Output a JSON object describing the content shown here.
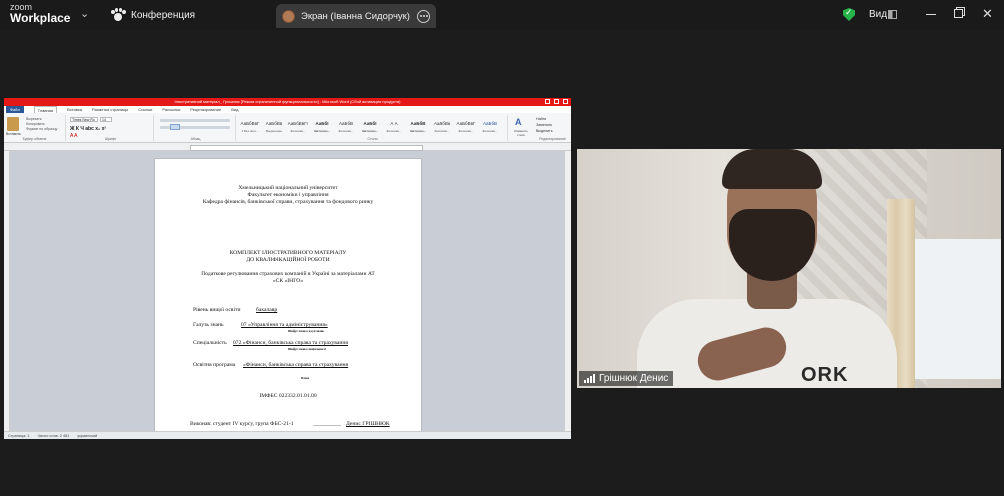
{
  "app": {
    "logo_line1": "zoom",
    "logo_line2": "Workplace",
    "meeting_label": "Конференция",
    "share_tab_label": "Экран (Іванна Сидорчук)",
    "view_label": "Вид"
  },
  "word": {
    "title": "Ілюстративний матеріал_ Гришнюк [Режим ограниченной функциональности] - Microsoft Word (Сбой активации продукта)",
    "tabs": [
      "Файл",
      "Главная",
      "Вставка",
      "Разметка страницы",
      "Ссылки",
      "Рассылки",
      "Рецензирование",
      "Вид"
    ],
    "font_name": "Times New Ro",
    "font_size": "14",
    "group_labels": [
      "Буфер обмена",
      "Шрифт",
      "Абзац",
      "Стили",
      "Редактирование"
    ],
    "clipboard_items": [
      "Вырезать",
      "Копировать",
      "Формат по образцу"
    ],
    "paste_label": "Вставить",
    "styles": [
      {
        "sample": "АаБбВвГ",
        "name": "1 Без инте..."
      },
      {
        "sample": "АаБбВв",
        "name": "Выделение"
      },
      {
        "sample": "АаБбВвГг",
        "name": "Заголово..."
      },
      {
        "sample": "АаБбІ",
        "name": "Заголово..."
      },
      {
        "sample": "АаБбВ",
        "name": "Заголово..."
      },
      {
        "sample": "АаБбІ",
        "name": "Заголово..."
      },
      {
        "sample": "А А",
        "name": "Заголово..."
      },
      {
        "sample": "АаБбВ",
        "name": "Заголово..."
      },
      {
        "sample": "АаБбВв",
        "name": "Заголово..."
      },
      {
        "sample": "АаБбВвГ",
        "name": "Заголово..."
      },
      {
        "sample": "АаБбВ",
        "name": "Заголово..."
      },
      {
        "sample": "АаБбВ",
        "name": "Название"
      }
    ],
    "change_styles": "Изменить стили",
    "editing": [
      "Найти",
      "Заменить",
      "Выделить"
    ],
    "status": [
      "Страница: 1",
      "Число слов: 2 481",
      "украинский"
    ]
  },
  "document": {
    "uni": "Хмельницький національний університет",
    "faculty": "Факультет економіки і управління",
    "department": "Кафедра фінансів, банківської справи, страхування та фондового ринку",
    "heading1": "КОМПЛЕКТ ІЛЮСТРАТИВНОГО МАТЕРІАЛУ",
    "heading2": "ДО  КВАЛІФІКАЦІЙНОЇ РОБОТИ",
    "topic1": "Податкове регулювання страхових компаній в Україні за матеріалами АТ",
    "topic2": "«СК «ІНГО»",
    "level_label": "Рівень вищої освіти",
    "level_value": "бакалавр",
    "field_label": "Галузь знань",
    "field_value": "07 «Управління та адміністрування»",
    "field_hint": "Шифр і назва галузі знань",
    "spec_label": "Спеціальність",
    "spec_value": "072 «Фінанси, банківська справа та страхування",
    "spec_hint": "Шифр і назва спеціальності",
    "prog_label": "Освітня програма",
    "prog_value": "«Фінанси, банківська справа та страхування",
    "prog_hint": "Назва",
    "code": "ІМФБС 022332.01.01.00",
    "executor": "Виконав: студент IV курсу, група ФБС-21-1",
    "executor_name": "Денис ГРІШНЮК"
  },
  "camera": {
    "participant": "Грішнюк Денис",
    "shirt_text": "ORK"
  }
}
